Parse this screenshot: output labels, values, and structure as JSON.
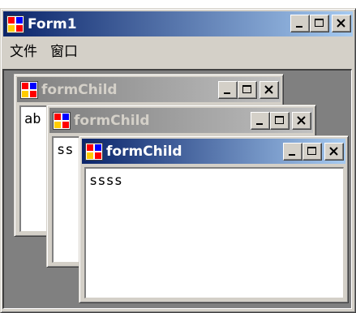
{
  "main_window": {
    "title": "Form1",
    "menu": [
      "文件",
      "窗口"
    ],
    "active": true
  },
  "children": [
    {
      "title": "formChild",
      "text": "ab",
      "active": false
    },
    {
      "title": "formChild",
      "text": "ss",
      "active": false
    },
    {
      "title": "formChild",
      "text": "ssss",
      "active": true
    }
  ],
  "colors": {
    "active_title_start": "#0a246a",
    "active_title_end": "#a6caf0",
    "inactive_title_start": "#808080",
    "inactive_title_end": "#c0c0c0",
    "face": "#d4d0c8",
    "mdi_background": "#808080"
  },
  "icons": {
    "app": "app-icon",
    "minimize": "minimize-icon",
    "maximize": "maximize-icon",
    "close": "close-icon"
  }
}
